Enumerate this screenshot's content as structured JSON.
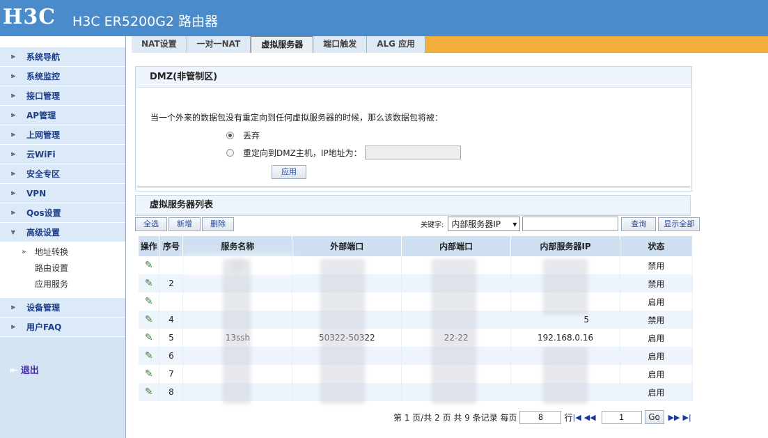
{
  "header": {
    "logo": "H3C",
    "product": "H3C ER5200G2 路由器"
  },
  "sidebar": {
    "items": [
      {
        "label": "系统导航"
      },
      {
        "label": "系统监控"
      },
      {
        "label": "接口管理"
      },
      {
        "label": "AP管理"
      },
      {
        "label": "上网管理"
      },
      {
        "label": "云WiFi"
      },
      {
        "label": "安全专区"
      },
      {
        "label": "VPN"
      },
      {
        "label": "Qos设置"
      },
      {
        "label": "高级设置"
      }
    ],
    "subitems": [
      {
        "label": "地址转换"
      },
      {
        "label": "路由设置"
      },
      {
        "label": "应用服务"
      }
    ],
    "items_after": [
      {
        "label": "设备管理"
      },
      {
        "label": "用户FAQ"
      }
    ],
    "logout": "退出"
  },
  "tabs": [
    {
      "label": "NAT设置"
    },
    {
      "label": "一对一NAT"
    },
    {
      "label": "虚拟服务器"
    },
    {
      "label": "端口触发"
    },
    {
      "label": "ALG 应用"
    }
  ],
  "dmz": {
    "title": "DMZ(非管制区)",
    "prompt": "当一个外来的数据包没有重定向到任何虚拟服务器的时候，那么该数据包将被：",
    "option_drop": "丢弃",
    "option_redirect": "重定向到DMZ主机，IP地址为：",
    "ip_value": "",
    "apply": "应用"
  },
  "vs": {
    "title": "虚拟服务器列表",
    "select_all": "全选",
    "add": "新增",
    "delete": "删除",
    "keyword_label": "关键字:",
    "keyword_select": "内部服务器IP",
    "keyword_value": "",
    "query": "查询",
    "show_all": "显示全部",
    "columns": [
      "操作",
      "序号",
      "服务名称",
      "外部端口",
      "内部端口",
      "内部服务器IP",
      "状态"
    ],
    "rows": [
      {
        "seq": "",
        "name": "30",
        "ext": "",
        "int": "",
        "ip": "",
        "status": "禁用"
      },
      {
        "seq": "2",
        "name": "",
        "ext": "",
        "int": "",
        "ip": "",
        "status": "禁用"
      },
      {
        "seq": "",
        "name": "",
        "ext": "",
        "int": "",
        "ip": "",
        "status": "启用"
      },
      {
        "seq": "4",
        "name": "",
        "ext": "",
        "int": "",
        "ip": "5",
        "status": "禁用"
      },
      {
        "seq": "5",
        "name": "13ssh",
        "ext": "50322-50322",
        "int": "22-22",
        "ip": "192.168.0.16",
        "status": "启用"
      },
      {
        "seq": "6",
        "name": "",
        "ext": "",
        "int": "",
        "ip": "",
        "status": "启用"
      },
      {
        "seq": "7",
        "name": "",
        "ext": "",
        "int": "",
        "ip": "",
        "status": "启用"
      },
      {
        "seq": "8",
        "name": "",
        "ext": "",
        "int": "",
        "ip": "",
        "status": "启用"
      }
    ],
    "pager": {
      "info": "第 1 页/共 2 页 共 9 条记录 每页",
      "per_page": "8",
      "row_label": "行",
      "page": "1",
      "go": "Go"
    }
  },
  "colors": {
    "header": "#4a8ccb",
    "tabbar": "#f2ae3a",
    "sidebar": "#d4e4f3"
  }
}
